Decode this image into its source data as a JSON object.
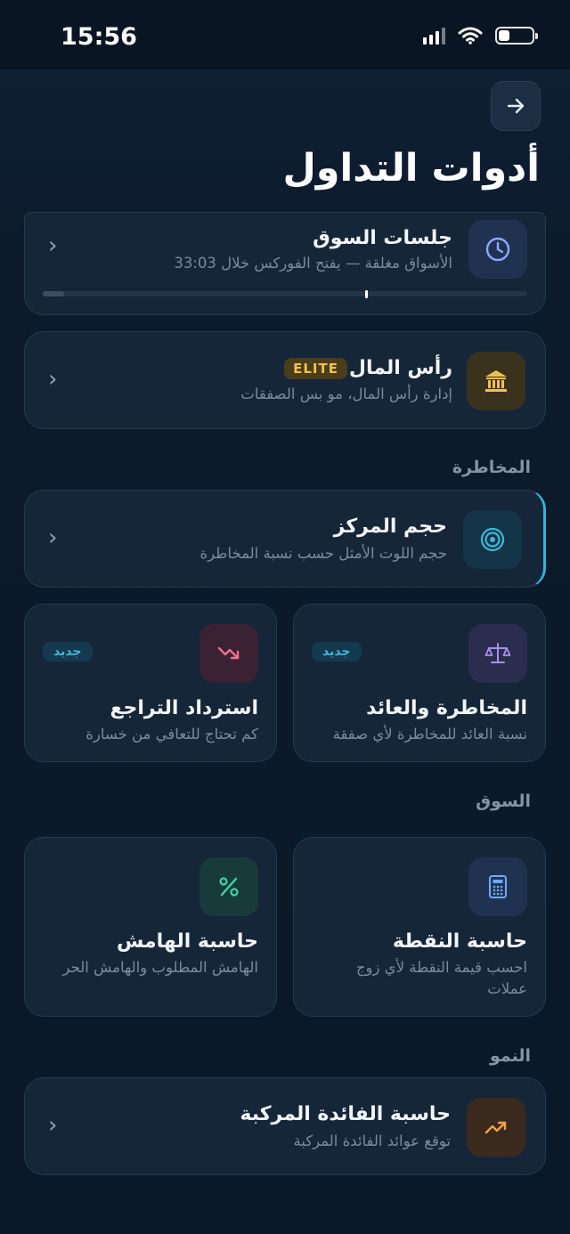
{
  "status": {
    "time": "15:56"
  },
  "header": {
    "title": "أدوات التداول"
  },
  "market_sessions": {
    "title": "جلسات السوق",
    "subtitle": "الأسواق مغلقة — يفتح الفوركس خلال 33:03"
  },
  "capital": {
    "title": "رأس المال",
    "badge": "ELITE",
    "subtitle": "إدارة رأس المال، مو بس الصفقات"
  },
  "sections": {
    "risk": "المخاطرة",
    "market": "السوق",
    "growth": "النمو"
  },
  "position_size": {
    "title": "حجم المركز",
    "subtitle": "حجم اللوت الأمثل حسب نسبة المخاطرة"
  },
  "risk_reward": {
    "badge": "جديد",
    "title": "المخاطرة والعائد",
    "subtitle": "نسبة العائد للمخاطرة لأي صفقة"
  },
  "drawdown": {
    "badge": "جديد",
    "title": "استرداد التراجع",
    "subtitle": "كم تحتاج للتعافي من خسارة"
  },
  "pip_calc": {
    "title": "حاسبة النقطة",
    "subtitle_line1": "احسب قيمة النقطة لأي زوج",
    "subtitle_line2": "عملات"
  },
  "margin_calc": {
    "title": "حاسبة الهامش",
    "subtitle": "الهامش المطلوب والهامش الحر"
  },
  "compound": {
    "title": "حاسبة الفائدة المركبة",
    "subtitle": "توقع عوائد الفائدة المركبة"
  },
  "colors": {
    "background": "#0c1a2b",
    "card": "#152639",
    "elite": "#f2c04a",
    "new_badge": "#3fb8d8",
    "accent": "#2fb6d6"
  }
}
